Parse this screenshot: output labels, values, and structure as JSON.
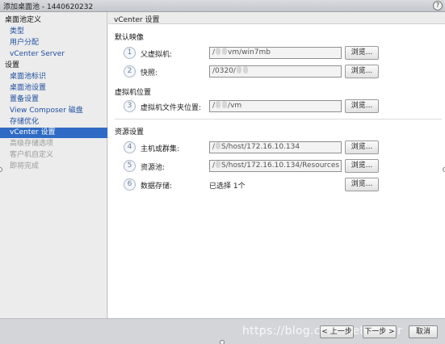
{
  "window": {
    "title": "添加桌面池 - 1440620232",
    "help_label": "?"
  },
  "sidebar": {
    "items": [
      {
        "label": "桌面池定义",
        "kind": "header"
      },
      {
        "label": "类型",
        "kind": "link"
      },
      {
        "label": "用户分配",
        "kind": "link"
      },
      {
        "label": "vCenter Server",
        "kind": "link"
      },
      {
        "label": "设置",
        "kind": "header"
      },
      {
        "label": "桌面池标识",
        "kind": "link"
      },
      {
        "label": "桌面池设置",
        "kind": "link"
      },
      {
        "label": "置备设置",
        "kind": "link"
      },
      {
        "label": "View Composer 磁盘",
        "kind": "link"
      },
      {
        "label": "存储优化",
        "kind": "link"
      },
      {
        "label": "vCenter 设置",
        "kind": "active"
      },
      {
        "label": "高级存储选项",
        "kind": "disabled"
      },
      {
        "label": "客户机自定义",
        "kind": "disabled"
      },
      {
        "label": "即将完成",
        "kind": "disabled"
      }
    ]
  },
  "main": {
    "title": "vCenter 设置",
    "sections": {
      "default_image": "默认映像",
      "vm_location": "虚拟机位置",
      "resource_settings": "资源设置"
    },
    "fields": [
      {
        "step": "1",
        "label": "父虚拟机:",
        "value_prefix": "/",
        "value_suffix": "vm/win7mb",
        "button": "浏览..."
      },
      {
        "step": "2",
        "label": "快照:",
        "value_prefix": "/0320/",
        "value_suffix": "",
        "button": "浏览..."
      },
      {
        "step": "3",
        "label": "虚拟机文件夹位置:",
        "value_prefix": "/",
        "value_suffix": "/vm",
        "button": "浏览..."
      },
      {
        "step": "4",
        "label": "主机或群集:",
        "value_prefix": "/",
        "value_suffix": "S/host/172.16.10.134",
        "button": "浏览..."
      },
      {
        "step": "5",
        "label": "资源池:",
        "value_prefix": "/",
        "value_suffix": "S/host/172.16.10.134/Resources",
        "button": "浏览..."
      },
      {
        "step": "6",
        "label": "数据存储:",
        "value": "已选择 1个",
        "button": "浏览..."
      }
    ]
  },
  "footer": {
    "watermark": "https://blog.csdn.net/lyfqyr",
    "back_label": "< 上一步",
    "next_label": "下一步 >",
    "cancel_label": "取消"
  }
}
